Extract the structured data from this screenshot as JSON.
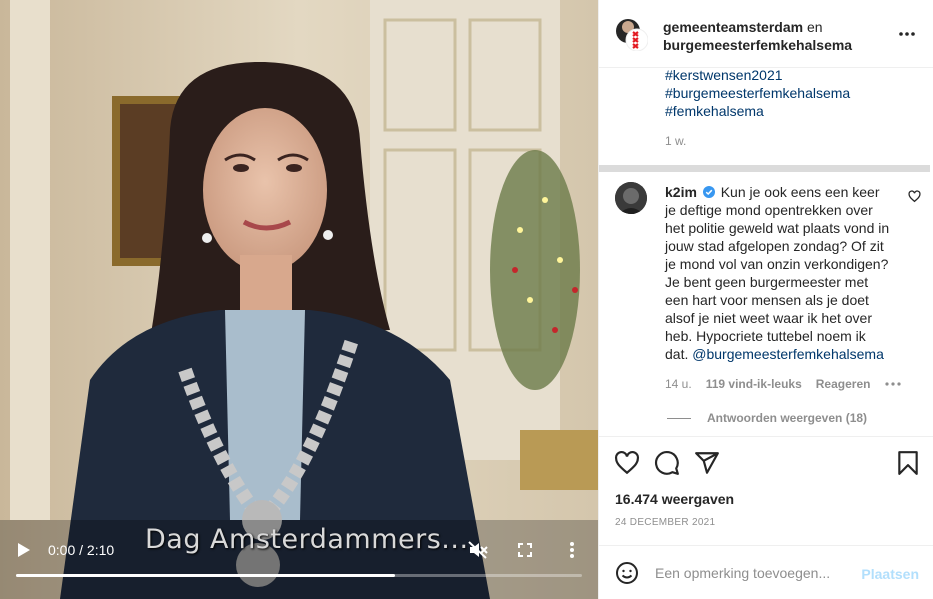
{
  "video": {
    "time": "0:00 / 2:10",
    "subtitle": "Dag Amsterdammers...",
    "progress": 0.67
  },
  "header": {
    "user1": "gemeenteamsterdam",
    "joiner": " en",
    "user2": "burgemeesterfemkehalsema"
  },
  "caption": {
    "tags": [
      "#kerstwensen2021",
      "#burgemeesterfemkehalsema",
      "#femkehalsema"
    ],
    "age": "1 w."
  },
  "comment": {
    "username": "k2im",
    "text": "Kun je ook eens een keer je deftige mond opentrekken over het politie geweld wat plaats vond in jouw stad afgelopen zondag? Of zit je mond vol van onzin verkondigen? Je bent geen burgermeester met een hart voor mensen als je doet alsof je niet weet waar ik het over heb. Hypocriete tuttebel noem ik dat.",
    "mention": "@burgemeesterfemkehalsema",
    "age": "14 u.",
    "likes": "119 vind-ik-leuks",
    "reply": "Reageren",
    "view_replies": "Antwoorden weergeven (18)"
  },
  "stats": {
    "views": "16.474 weergaven",
    "date": "24 DECEMBER 2021"
  },
  "composer": {
    "placeholder": "Een opmerking toevoegen...",
    "post": "Plaatsen"
  },
  "colors": {
    "link": "#00376b",
    "muted": "#8e8e8e",
    "post_disabled": "#b2dffc",
    "verified": "#3897f0",
    "amsterdam_red": "#e31b23"
  }
}
